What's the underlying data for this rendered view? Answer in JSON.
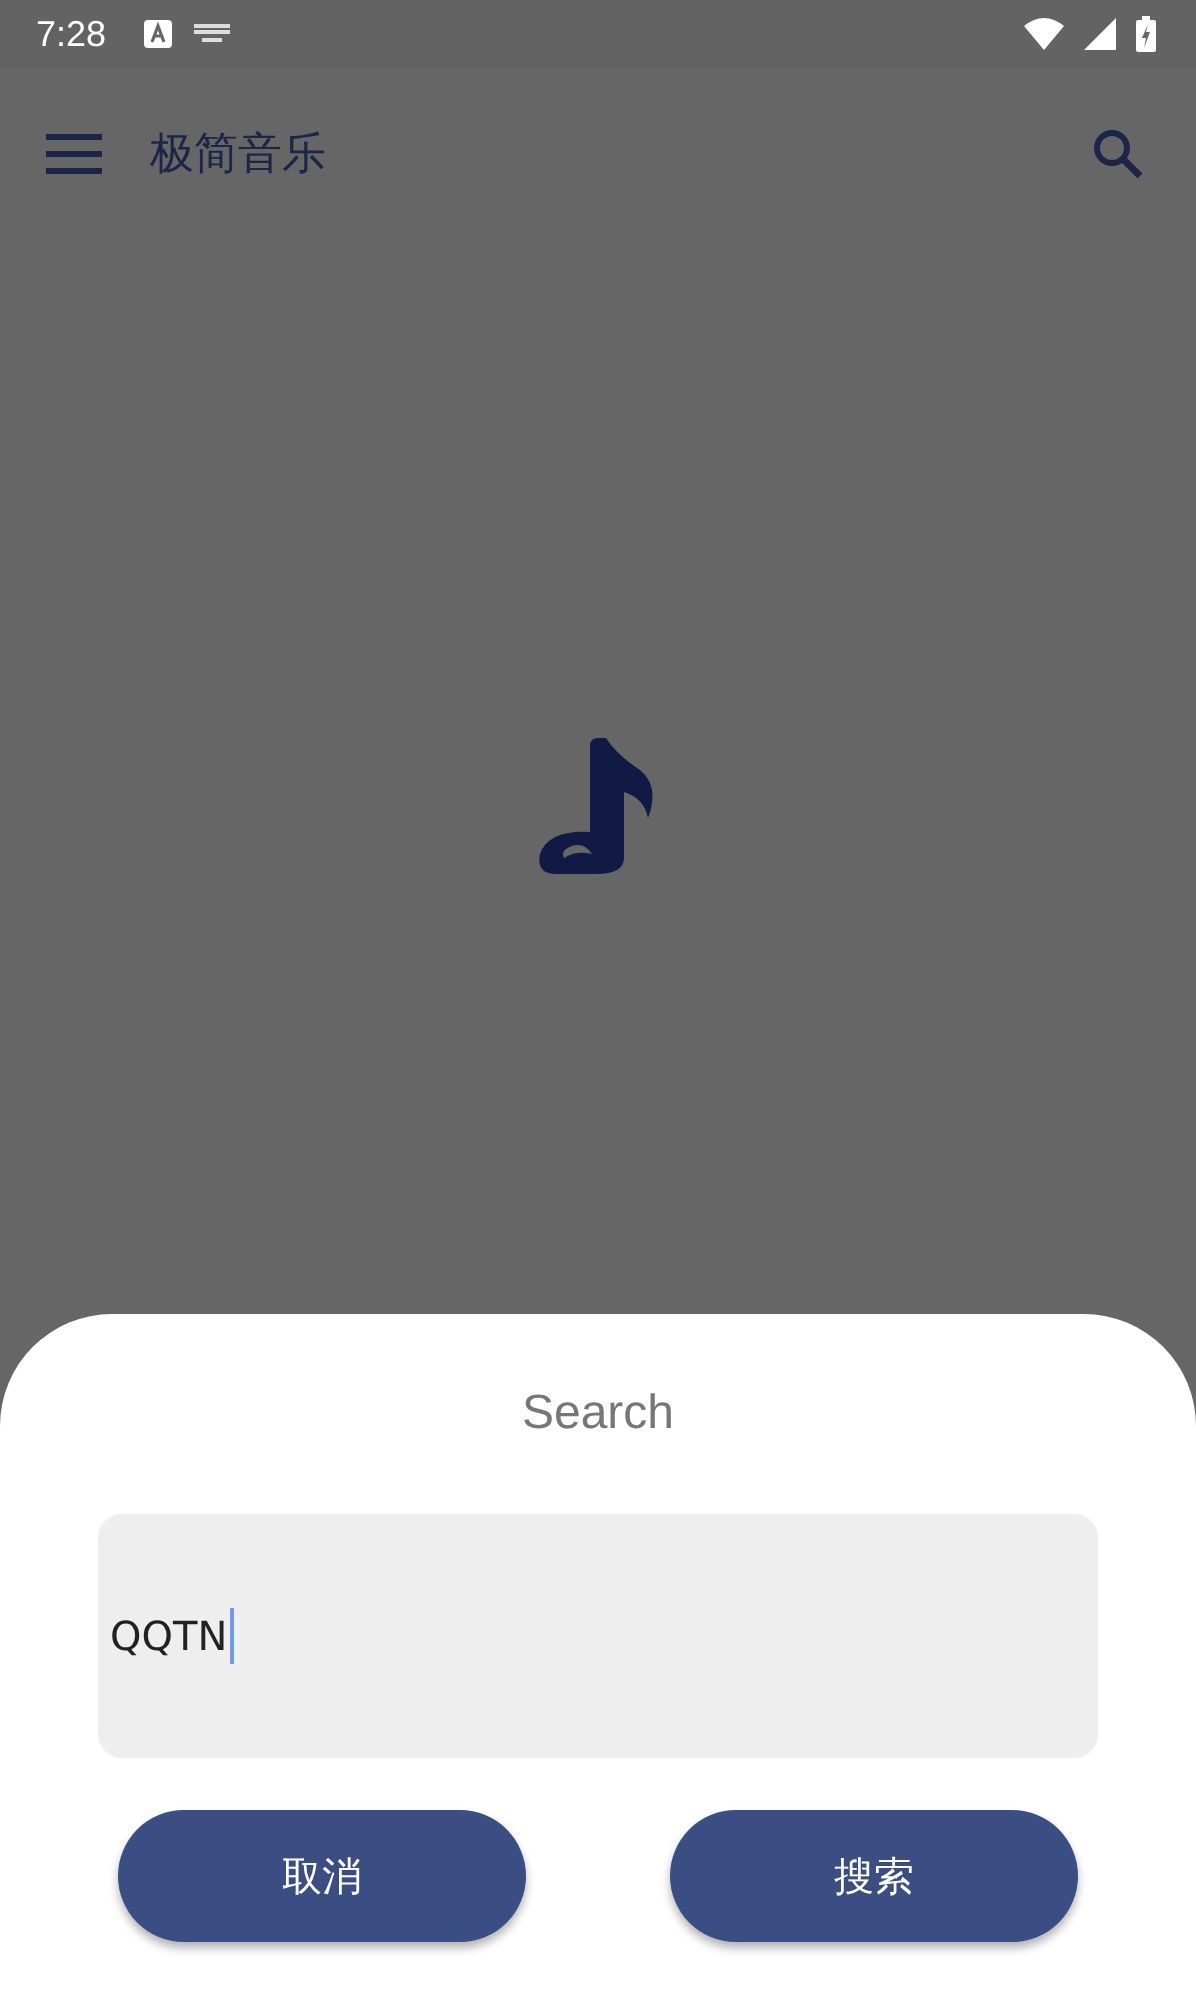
{
  "status_bar": {
    "time": "7:28"
  },
  "app_bar": {
    "title": "极简音乐"
  },
  "dialog": {
    "title": "Search",
    "input": {
      "value": "QQTN"
    },
    "buttons": [
      {
        "label": "取消"
      },
      {
        "label": "搜索"
      }
    ]
  }
}
